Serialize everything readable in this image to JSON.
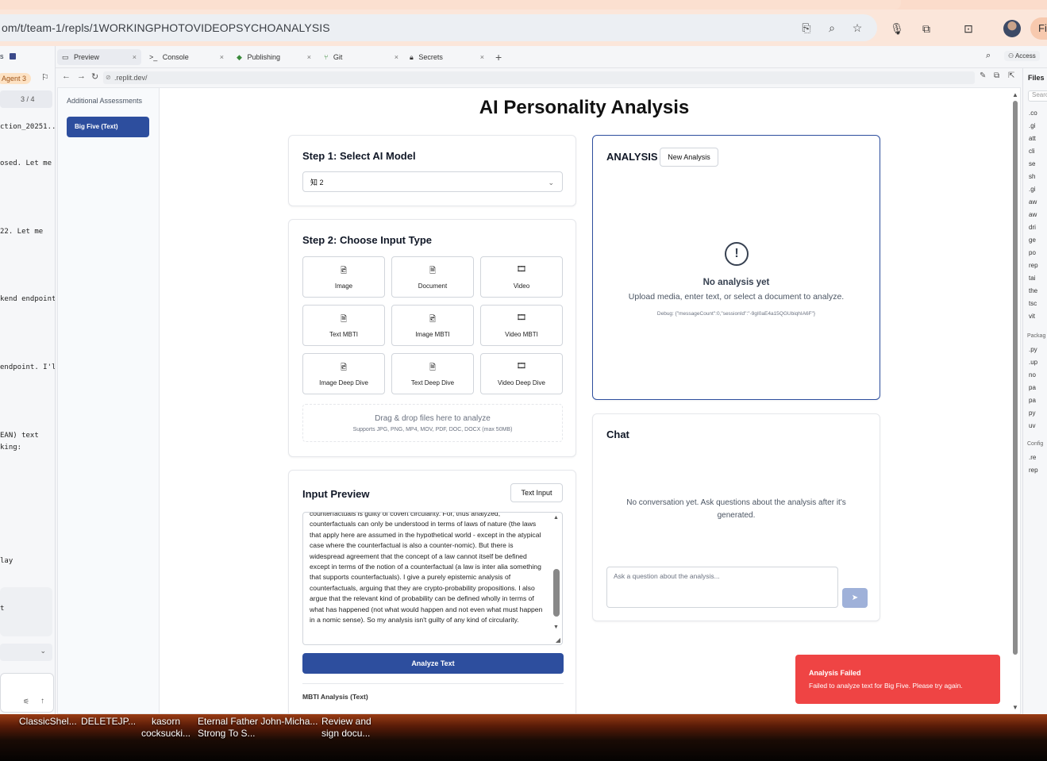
{
  "browser": {
    "url": "om/t/team-1/repls/1WORKINGPHOTOVIDEOPSYCHOANALYSIS",
    "profile_label": "Fi"
  },
  "workspace": {
    "tabs": [
      {
        "icon": "preview-icon",
        "label": "Preview",
        "glyph": "▭"
      },
      {
        "icon": "console-icon",
        "label": "Console",
        "glyph": ">_"
      },
      {
        "icon": "publishing-icon",
        "label": "Publishing",
        "glyph": "◆"
      },
      {
        "icon": "git-icon",
        "label": "Git",
        "glyph": "⑂"
      },
      {
        "icon": "lock-icon",
        "label": "Secrets",
        "glyph": "🔒︎"
      }
    ],
    "close_glyph": "×",
    "add_tab_glyph": "+",
    "access_label": "Access",
    "preview_url": ".replit.dev/"
  },
  "agent_panel": {
    "tab_stub": "s",
    "agent_label": "Agent 3",
    "progress": "3 / 4",
    "snippets": [
      "ction_20251...",
      "osed. Let me",
      "22. Let me",
      "kend endpoint",
      "endpoint. I'll",
      "EAN) text",
      "king:",
      "lay",
      "t"
    ]
  },
  "files": {
    "title": "Files",
    "search_placeholder": "Search",
    "items": [
      ".co",
      ".gi",
      "att",
      "cli",
      "se",
      "sh",
      ".gi",
      "aw",
      "aw",
      "dri",
      "ge",
      "po",
      "rep",
      "tai",
      "the",
      "tsc",
      "vit"
    ],
    "packages_label": "Packag",
    "packages": [
      ".py",
      ".up",
      "no",
      "pa",
      "pa",
      "py",
      "uv"
    ],
    "config_label": "Config",
    "config": [
      ".re",
      "rep"
    ]
  },
  "app": {
    "title": "AI Personality Analysis",
    "sidebar": {
      "heading": "Additional Assessments",
      "active_button": "Big Five (Text)"
    },
    "step1": {
      "title": "Step 1: Select AI Model",
      "selected": "知 2"
    },
    "step2": {
      "title": "Step 2: Choose Input Type",
      "options": [
        {
          "label": "Image",
          "icon": "image-file-icon",
          "glyph": "🖻"
        },
        {
          "label": "Document",
          "icon": "document-icon",
          "glyph": "🗎"
        },
        {
          "label": "Video",
          "icon": "video-icon",
          "glyph": "🎞"
        },
        {
          "label": "Text MBTI",
          "icon": "document-icon",
          "glyph": "🗎"
        },
        {
          "label": "Image MBTI",
          "icon": "image-file-icon",
          "glyph": "🖻"
        },
        {
          "label": "Video MBTI",
          "icon": "video-icon",
          "glyph": "🎞"
        },
        {
          "label": "Image Deep Dive",
          "icon": "image-file-icon",
          "glyph": "🖻"
        },
        {
          "label": "Text Deep Dive",
          "icon": "document-icon",
          "glyph": "🗎"
        },
        {
          "label": "Video Deep Dive",
          "icon": "video-icon",
          "glyph": "🎞"
        }
      ],
      "dropzone_title": "Drag & drop files here to analyze",
      "dropzone_sub": "Supports JPG, PNG, MP4, MOV, PDF, DOC, DOCX (max 50MB)"
    },
    "input_preview": {
      "title": "Input Preview",
      "text_input_button": "Text Input",
      "text": "counterfactuals is guilty of covert circularity. For, thus analyzed, counterfactuals can only be understood in terms of laws of nature (the laws that apply here are assumed in the hypothetical world - except in the atypical case where the counterfactual is also a counter-nomic). But there is widespread agreement that the concept of a law cannot itself be defined except in terms of the notion of a counterfactual (a law is inter alia something that supports counterfactuals). I give a purely epistemic analysis of counterfactuals, arguing that they are crypto-probability propositions. I also argue that the relevant kind of probability can be defined wholly in terms of what has happened (not what would happen and not even what must happen in a nomic sense). So my analysis isn't guilty of any kind of circularity.",
      "analyze_button": "Analyze Text",
      "mbti_label": "MBTI Analysis (Text)"
    },
    "analysis": {
      "title": "ANALYSIS",
      "new_button": "New Analysis",
      "empty_title": "No analysis yet",
      "empty_sub": "Upload media, enter text, or select a document to analyze.",
      "debug": "Debug: {\"messageCount\":0,\"sessionId\":\"-9gI0aE4a15QGUbiqhIA6F\"}"
    },
    "chat": {
      "title": "Chat",
      "empty": "No conversation yet. Ask questions about the analysis after it's generated.",
      "placeholder": "Ask a question about the analysis..."
    },
    "toast": {
      "title": "Analysis Failed",
      "message": "Failed to analyze text for Big Five. Please try again."
    }
  },
  "taskbar": {
    "items": [
      "ClassicShel...",
      "DELETEJP...",
      "kasorn\ncocksucki...",
      "Eternal Father John-Micha...\nStrong To S...",
      "Review and\nsign docu..."
    ]
  }
}
